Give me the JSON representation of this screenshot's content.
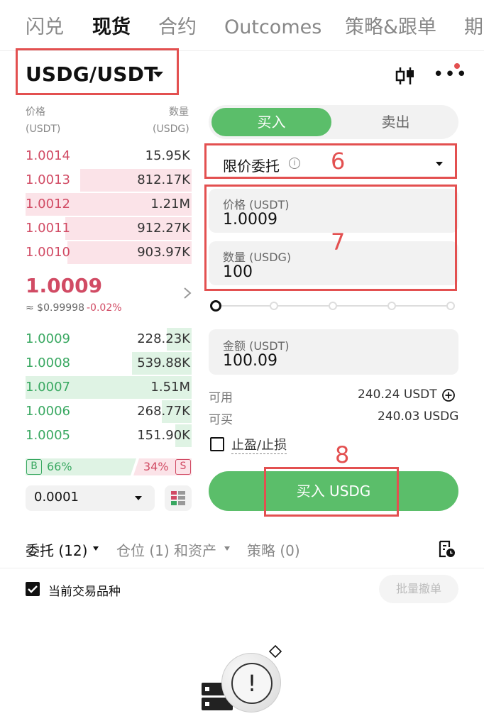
{
  "tabs": [
    "闪兑",
    "现货",
    "合约",
    "Outcomes",
    "策略&跟单",
    "期"
  ],
  "header": {
    "pair": "USDG/USDT",
    "annotations": [
      "6",
      "7",
      "8"
    ]
  },
  "orderbook": {
    "price_label": "价格",
    "price_unit": "(USDT)",
    "qty_label": "数量",
    "qty_unit": "(USDG)",
    "asks": [
      {
        "price": "1.0014",
        "qty": "15.95K",
        "depth": 0.0
      },
      {
        "price": "1.0013",
        "qty": "812.17K",
        "depth": 0.67
      },
      {
        "price": "1.0012",
        "qty": "1.21M",
        "depth": 1.0
      },
      {
        "price": "1.0011",
        "qty": "912.27K",
        "depth": 0.76
      },
      {
        "price": "1.0010",
        "qty": "903.97K",
        "depth": 0.75
      }
    ],
    "last_price": "1.0009",
    "last_usd": "≈ $0.99998",
    "change": "-0.02%",
    "bids": [
      {
        "price": "1.0009",
        "qty": "228.23K",
        "depth": 0.15
      },
      {
        "price": "1.0008",
        "qty": "539.88K",
        "depth": 0.36
      },
      {
        "price": "1.0007",
        "qty": "1.51M",
        "depth": 1.0
      },
      {
        "price": "1.0006",
        "qty": "268.77K",
        "depth": 0.18
      },
      {
        "price": "1.0005",
        "qty": "151.90K",
        "depth": 0.1
      }
    ],
    "buy_ratio_badge": "B",
    "buy_ratio": "66%",
    "sell_ratio": "34%",
    "sell_ratio_badge": "S",
    "precision": "0.0001"
  },
  "form": {
    "buy_label": "买入",
    "sell_label": "卖出",
    "order_type": "限价委托",
    "price_label": "价格 (USDT)",
    "price_value": "1.0009",
    "qty_label": "数量 (USDG)",
    "qty_value": "100",
    "amount_label": "金额 (USDT)",
    "amount_value": "100.09",
    "available_label": "可用",
    "available_value": "240.24 USDT",
    "can_buy_label": "可买",
    "can_buy_value": "240.03 USDG",
    "tpsl_label": "止盈/止损",
    "submit_label": "买入 USDG"
  },
  "bottom": {
    "orders_tab": "委托 (12)",
    "positions_tab": "仓位 (1) 和资产",
    "strategy_tab": "策略 (0)",
    "current_pair_label": "当前交易品种",
    "cancel_all_label": "批量撤单"
  },
  "colors": {
    "buy": "#5bbe6a",
    "sell": "#d14b64",
    "annotation": "#e35050"
  }
}
